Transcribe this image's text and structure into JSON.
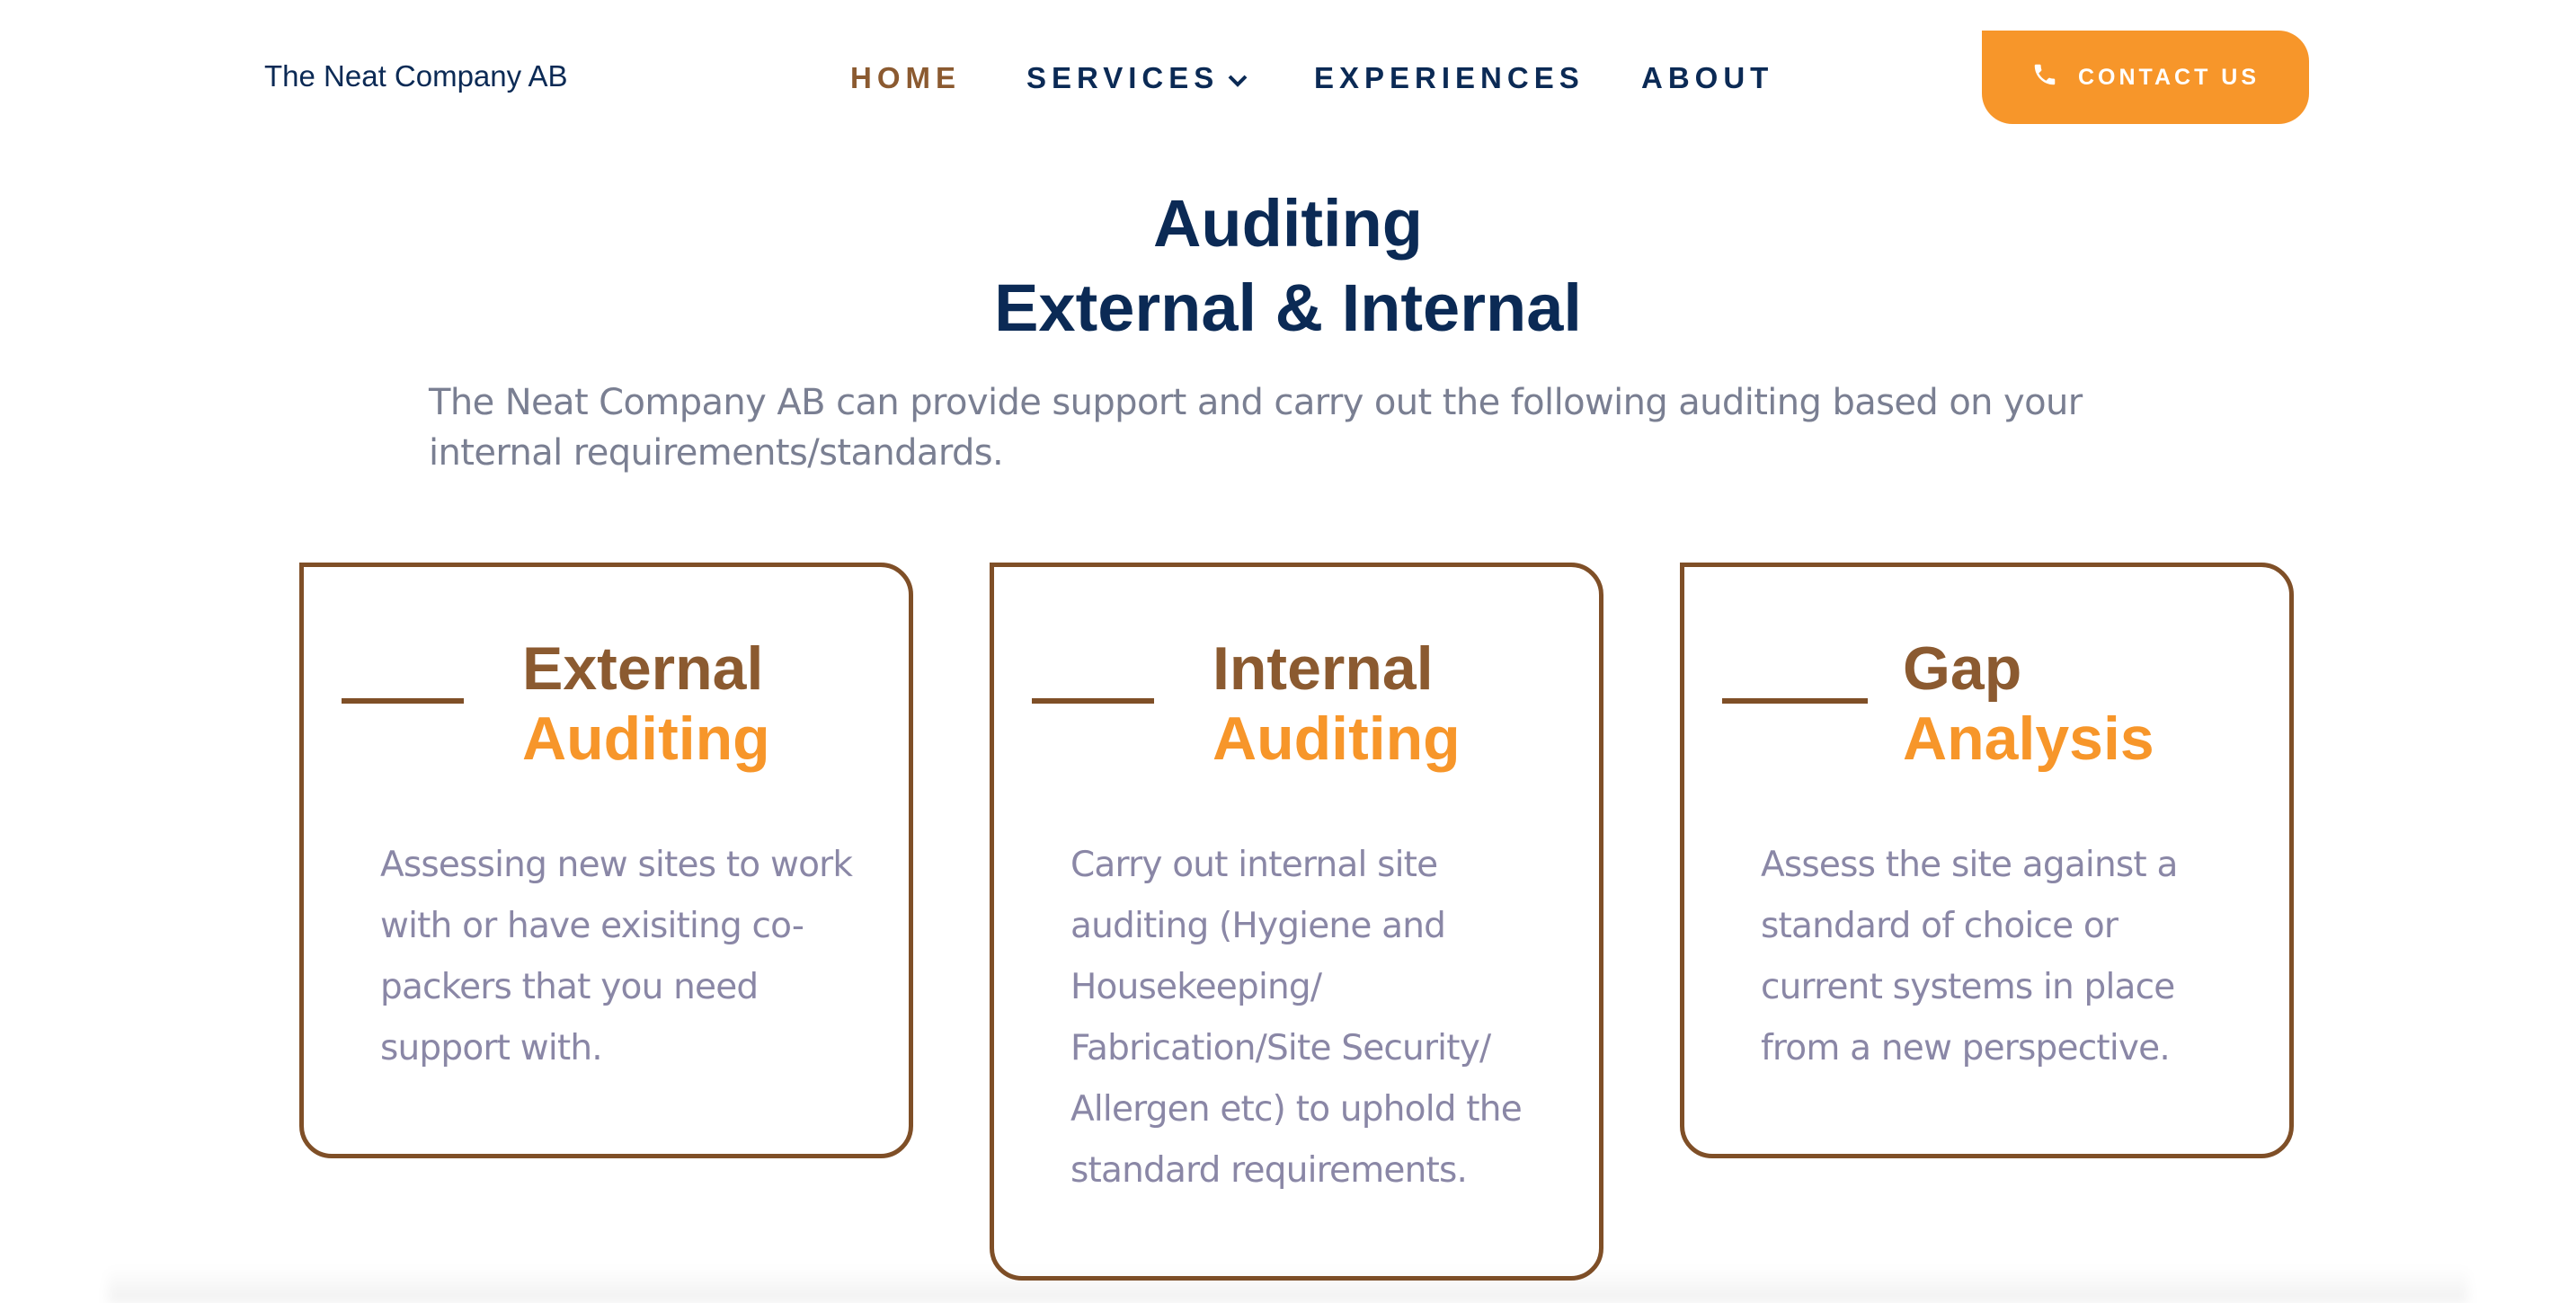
{
  "header": {
    "logo": "The Neat Company AB",
    "nav": {
      "home": "HOME",
      "services": "SERVICES",
      "experiences": "EXPERIENCES",
      "about": "ABOUT"
    },
    "contact_label": "CONTACT US",
    "contact_icon": "phone-icon"
  },
  "main": {
    "title_line1": "Auditing",
    "title_line2": "External & Internal",
    "intro": "The Neat Company AB can provide support and carry out the following auditing based on your internal requirements/standards."
  },
  "cards": [
    {
      "heading1": "External",
      "heading2": "Auditing",
      "text": "Assessing new sites to work with or have exisiting co-packers that you need support with."
    },
    {
      "heading1": "Internal",
      "heading2": "Auditing",
      "text": "Carry out internal site auditing (Hygiene and Housekeeping/ Fabrication/Site Security/ Allergen etc) to uphold the standard requirements."
    },
    {
      "heading1": "Gap",
      "heading2": "Analysis",
      "text": "Assess the site against a standard of choice or current systems in place from a new perspective."
    }
  ],
  "colors": {
    "navy": "#0b2a55",
    "brown": "#8b5a30",
    "orange": "#f7962a",
    "body_text": "#8a87a6"
  }
}
